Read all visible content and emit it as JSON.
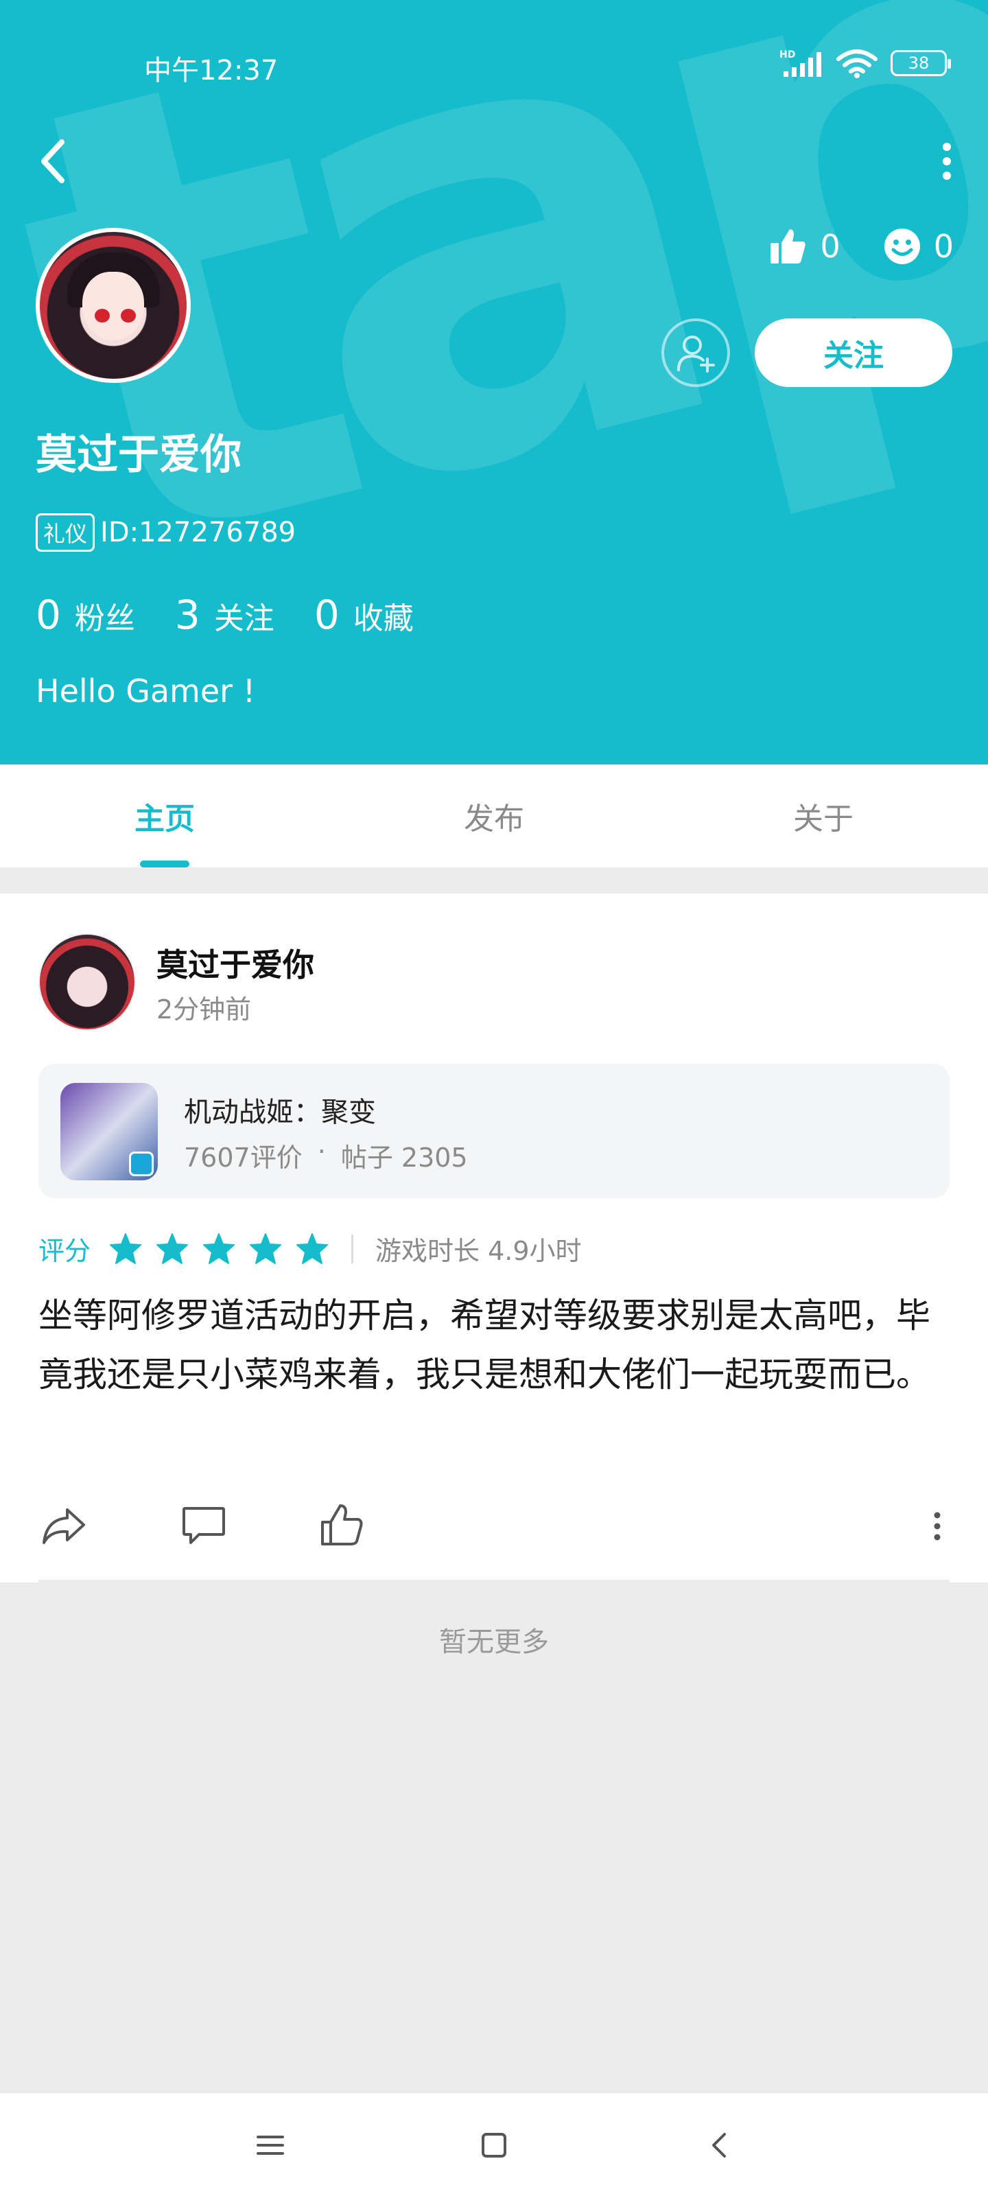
{
  "status_bar": {
    "time": "中午12:37",
    "battery": "38",
    "network": "HD"
  },
  "header": {
    "watermark": "tapta",
    "likes": "0",
    "emoji_count": "0",
    "follow_label": "关注",
    "username": "莫过于爱你",
    "badge": "礼仪",
    "id_text": "ID:127276789",
    "counts": [
      {
        "number": "0",
        "label": "粉丝"
      },
      {
        "number": "3",
        "label": "关注"
      },
      {
        "number": "0",
        "label": "收藏"
      }
    ],
    "bio": "Hello Gamer !"
  },
  "tabs": [
    {
      "label": "主页",
      "active": true
    },
    {
      "label": "发布",
      "active": false
    },
    {
      "label": "关于",
      "active": false
    }
  ],
  "post": {
    "author": "莫过于爱你",
    "time": "2分钟前",
    "game": {
      "name": "机动战姬：聚变",
      "reviews": "7607评价",
      "separator": "·",
      "posts": "帖子 2305"
    },
    "rating_label": "评分",
    "stars": 5,
    "play_time": "游戏时长 4.9小时",
    "text": "坐等阿修罗道活动的开启，希望对等级要求别是太高吧，毕竟我还是只小菜鸡来着，我只是想和大佬们一起玩耍而已。"
  },
  "footer_text": "暂无更多",
  "colors": {
    "accent": "#15bccc",
    "background": "#ececec"
  }
}
